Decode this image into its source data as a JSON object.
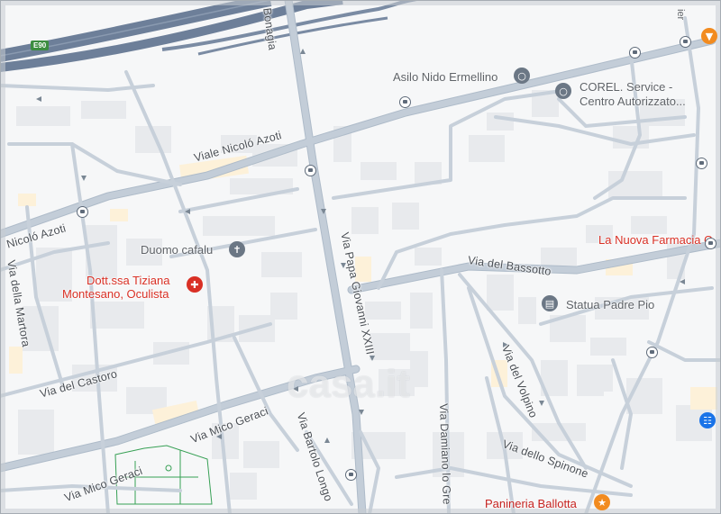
{
  "map": {
    "highway_shield": "E90",
    "streets": {
      "bonagia": "Bonagia",
      "viale_azoti": "Viale Nicoló Azoti",
      "azoti_left": "Nicoló Azoti",
      "papa_giovanni": "Via Papa Giovanni XXIII",
      "del_bassotto": "Via del Bassotto",
      "della_martora": "Via della Martora",
      "del_castoro": "Via del Castoro",
      "mico_geraci_1": "Via Mico Geraci",
      "mico_geraci_2": "Via Mico Geraci",
      "bartolo_longo": "Via Bartolo Longo",
      "damiano_lo_greco": "Via Damiano lo Gre",
      "del_volpino": "Via del Volpino",
      "dello_spinone": "Via dello Spinone"
    },
    "pois": {
      "asilo": "Asilo Nido Ermellino",
      "corel_1": "COREL. Service -",
      "corel_2": "Centro Autorizzato...",
      "duomo": "Duomo cafalu",
      "dott_1": "Dott.ssa Tiziana",
      "dott_2": "Montesano, Oculista",
      "farmacia": "La Nuova Farmacia C",
      "statua": "Statua Padre Pio",
      "panineria": "Panineria Ballotta"
    },
    "corner_text": "ier",
    "watermark": "casa.it",
    "colors": {
      "road": "#c3cdd8",
      "road_edge": "#aebbc9",
      "highway": "#6d7f99",
      "building": "#e8eaed",
      "commercial": "#fdf1d9",
      "park_outline": "#37a055",
      "poi_red": "#d93025",
      "poi_gray": "#6b7785",
      "orange": "#f28b1f",
      "blue": "#1a73e8"
    },
    "icons": [
      "bus-stop-icon",
      "school-pin-icon",
      "pin-icon",
      "cross-icon",
      "medical-icon",
      "museum-icon",
      "restaurant-icon",
      "cocktail-icon",
      "shopping-cart-icon"
    ]
  }
}
